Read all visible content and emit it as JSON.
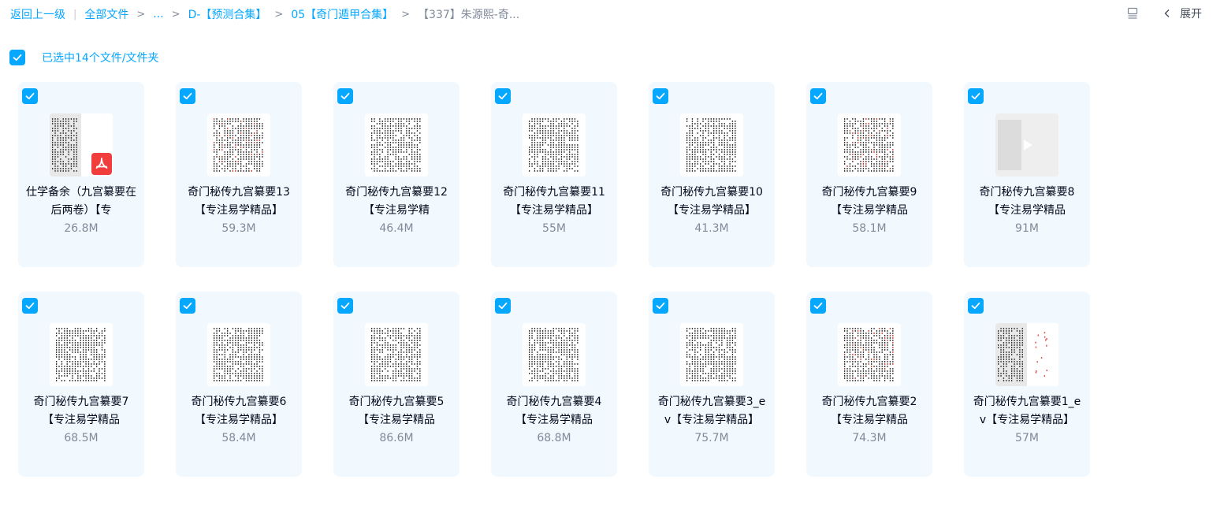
{
  "breadcrumb": {
    "back": "返回上一级",
    "root": "全部文件",
    "ellipsis": "...",
    "level1": "D-【预测合集】",
    "level2": "05【奇门遁甲合集】",
    "current": "【337】朱源熙-奇..."
  },
  "toolbar": {
    "expand": "展开"
  },
  "selection": {
    "text": "已选中14个文件/文件夹"
  },
  "colors": {
    "accent": "#06a7ff",
    "card_bg": "#f1f9ff",
    "pdf_red": "#f23d3d"
  },
  "files": [
    {
      "name": "仕学备余（九宫纂要在后两卷）【专",
      "size": "26.8M",
      "icon": "pdf-icon",
      "thumb": "half"
    },
    {
      "name": "奇门秘传九宫纂要13 【专注易学精品】",
      "size": "59.3M",
      "icon": "document-thumbnail",
      "thumb": "red"
    },
    {
      "name": "奇门秘传九宫纂要12 【专注易学精",
      "size": "46.4M",
      "icon": "document-thumbnail",
      "thumb": "plain"
    },
    {
      "name": "奇门秘传九宫纂要11 【专注易学精品】",
      "size": "55M",
      "icon": "document-thumbnail",
      "thumb": "plain"
    },
    {
      "name": "奇门秘传九宫纂要10 【专注易学精品】",
      "size": "41.3M",
      "icon": "document-thumbnail",
      "thumb": "plain"
    },
    {
      "name": "奇门秘传九宫纂要9【专注易学精品",
      "size": "58.1M",
      "icon": "document-thumbnail",
      "thumb": "red"
    },
    {
      "name": "奇门秘传九宫纂要8【专注易学精品",
      "size": "91M",
      "icon": "video-thumbnail",
      "thumb": "video"
    },
    {
      "name": "奇门秘传九宫纂要7【专注易学精品",
      "size": "68.5M",
      "icon": "document-thumbnail",
      "thumb": "plain"
    },
    {
      "name": "奇门秘传九宫纂要6【专注易学精品】",
      "size": "58.4M",
      "icon": "document-thumbnail",
      "thumb": "plain"
    },
    {
      "name": "奇门秘传九宫纂要5【专注易学精品",
      "size": "86.6M",
      "icon": "document-thumbnail",
      "thumb": "plain"
    },
    {
      "name": "奇门秘传九宫纂要4【专注易学精品",
      "size": "68.8M",
      "icon": "document-thumbnail",
      "thumb": "plain"
    },
    {
      "name": "奇门秘传九宫纂要3_ev【专注易学精品】",
      "size": "75.7M",
      "icon": "document-thumbnail",
      "thumb": "plain"
    },
    {
      "name": "奇门秘传九宫纂要2【专注易学精品",
      "size": "74.3M",
      "icon": "document-thumbnail",
      "thumb": "red"
    },
    {
      "name": "奇门秘传九宫纂要1_ev【专注易学精品】",
      "size": "57M",
      "icon": "document-thumbnail",
      "thumb": "halfred"
    }
  ]
}
